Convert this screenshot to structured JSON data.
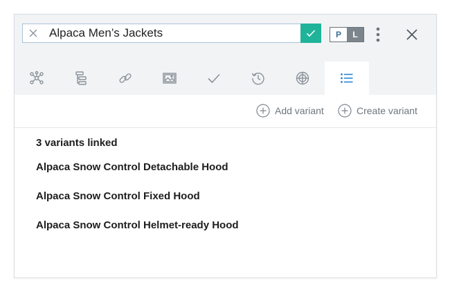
{
  "header": {
    "title_value": "Alpaca Men’s Jackets",
    "toggle": {
      "p_label": "P",
      "l_label": "L",
      "selected": "L"
    }
  },
  "tabs": [
    {
      "icon": "network-icon"
    },
    {
      "icon": "hierarchy-icon"
    },
    {
      "icon": "link-icon"
    },
    {
      "icon": "image-icon"
    },
    {
      "icon": "check-icon"
    },
    {
      "icon": "history-icon"
    },
    {
      "icon": "globe-icon"
    },
    {
      "icon": "list-icon",
      "active": true
    }
  ],
  "actions": {
    "add_variant": "Add variant",
    "create_variant": "Create variant"
  },
  "variants": {
    "count_label": "3 variants linked",
    "items": [
      "Alpaca Snow Control Detachable Hood",
      "Alpaca Snow Control Fixed Hood",
      "Alpaca Snow Control Helmet-ready Hood"
    ]
  },
  "colors": {
    "accent": "#1fb39a",
    "active_tab_icon": "#1c7fd1",
    "icon_gray": "#8a9299",
    "header_bg": "#f1f3f5"
  }
}
